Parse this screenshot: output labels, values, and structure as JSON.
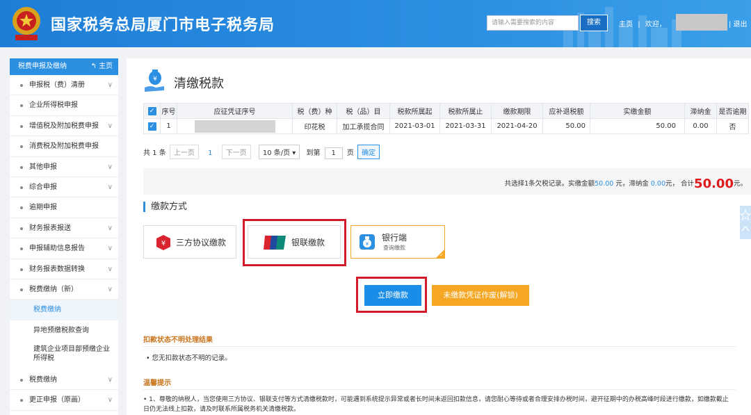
{
  "header": {
    "site_title": "国家税务总局厦门市电子税务局",
    "search_placeholder": "请输入需要搜索的内容",
    "search_button": "搜索",
    "nav_home": "主页",
    "nav_sep": "|",
    "nav_welcome": "欢迎，",
    "nav_logout": "| 退出"
  },
  "sidebar": {
    "head_label": "税费申报及缴纳",
    "head_home": "主页",
    "items": [
      {
        "label": "申报税（费）清册",
        "chev": "∨"
      },
      {
        "label": "企业所得税申报",
        "chev": ""
      },
      {
        "label": "增值税及附加税费申报",
        "chev": "∨"
      },
      {
        "label": "消费税及附加税费申报",
        "chev": ""
      },
      {
        "label": "其他申报",
        "chev": "∨"
      },
      {
        "label": "综合申报",
        "chev": "∨"
      },
      {
        "label": "逾期申报",
        "chev": ""
      },
      {
        "label": "财务报表报送",
        "chev": "∨"
      },
      {
        "label": "申报辅助信息报告",
        "chev": "∨"
      },
      {
        "label": "财务报表数据转换",
        "chev": "∨"
      },
      {
        "label": "税费缴纳（新）",
        "chev": "∨"
      }
    ],
    "sub_items": [
      {
        "label": "税费缴纳"
      },
      {
        "label": "异地预缴税款查询"
      },
      {
        "label": "建筑企业项目部预缴企业所得税"
      }
    ],
    "after_items": [
      {
        "label": "税费缴纳",
        "chev": "∨"
      },
      {
        "label": "更正申报（原画）",
        "chev": "∨"
      }
    ]
  },
  "main": {
    "page_title": "清缴税款",
    "table": {
      "headers": [
        "序号",
        "应征凭证序号",
        "税（费）种",
        "税（品）目",
        "税款所属起",
        "税款所属止",
        "缴款期限",
        "应补退税额",
        "实缴金额",
        "滞纳金",
        "是否逾期"
      ],
      "rows": [
        {
          "seq": "1",
          "tax_type": "印花税",
          "tax_item": "加工承揽合同",
          "period_start": "2021-03-01",
          "period_end": "2021-03-31",
          "deadline": "2021-04-20",
          "due": "50.00",
          "paid": "50.00",
          "late_fee": "0.00",
          "overdue": "否"
        }
      ]
    },
    "pager": {
      "total": "共 1 条",
      "prev": "上一页",
      "page": "1",
      "next": "下一页",
      "page_size": "10 条/页 ▾",
      "goto": "到第",
      "goto_value": "1",
      "page_unit": "页",
      "confirm": "确定"
    },
    "summary": {
      "prefix": "共选择1条欠税记录。实缴金额",
      "paid_amount": "50.00",
      "mid1": " 元，滞纳金 ",
      "late_amount": "0.00",
      "mid2": "元， 合计",
      "total": "50.00",
      "suffix": "元。"
    },
    "pay_section_title": "缴款方式",
    "pay_methods": [
      {
        "label": "三方协议缴款"
      },
      {
        "label": "银联缴款"
      },
      {
        "label": "银行端",
        "sub": "查询缴款"
      }
    ],
    "pay_now": "立即缴款",
    "void_voucher": "未缴款凭证作废(解锁)",
    "status_title": "扣款状态不明处理结果",
    "status_note": "•  您无扣款状态不明的记录。",
    "tips_title": "温馨提示",
    "tips_text": "•      1、尊敬的纳税人，当您使用三方协议、银联支付等方式清缴税款时，可能遇到系统提示异常或者长时间未返回扣款信息，请您耐心等待或者合理安排办税时间，避开征期中的办税高峰时段进行缴款，如缴款截止日仍无法线上扣款，请及时联系所属税务机关清缴税款。"
  },
  "colors": {
    "brand_blue": "#2b8fe2",
    "highlight_red": "#d21b2a",
    "accent_orange": "#f5a623",
    "total_red": "#e01b1b"
  }
}
